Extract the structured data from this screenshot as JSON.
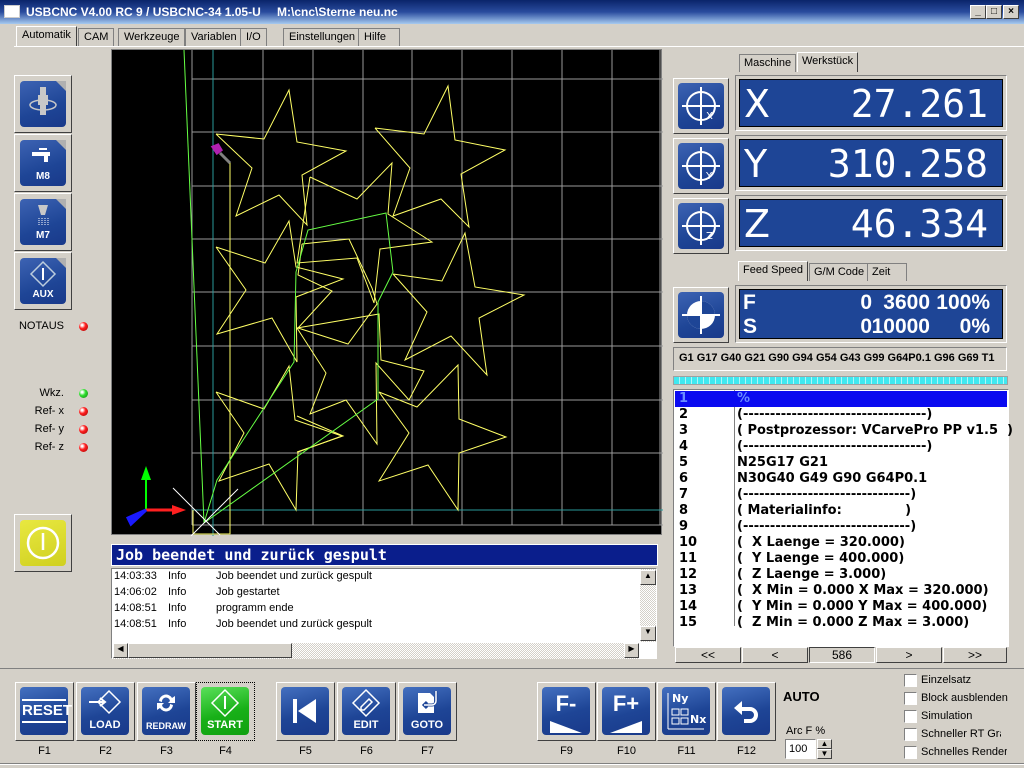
{
  "window": {
    "title": "USBCNC V4.00 RC 9 / USBCNC-34 1.05-U",
    "file": "M:\\cnc\\Sterne neu.nc",
    "minimize": "_",
    "maximize": "□",
    "close": "×"
  },
  "tabs": [
    {
      "label": "Automatik",
      "active": true
    },
    {
      "label": "CAM"
    },
    {
      "label": "Werkzeuge"
    },
    {
      "label": "Variablen"
    },
    {
      "label": "I/O"
    },
    {
      "label": "Einstellungen"
    },
    {
      "label": "Hilfe"
    }
  ],
  "side_buttons": [
    {
      "icon": "spindle-icon",
      "label": ""
    },
    {
      "icon": "flood-coolant-icon",
      "label": "M8"
    },
    {
      "icon": "mist-coolant-icon",
      "label": "M7"
    },
    {
      "icon": "aux-icon",
      "label": "AUX"
    }
  ],
  "status": {
    "notaus": {
      "label": "NOTAUS",
      "color": "red"
    },
    "leds": [
      {
        "label": "Wkz.",
        "color": "green"
      },
      {
        "label": "Ref- x",
        "color": "red"
      },
      {
        "label": "Ref- y",
        "color": "red"
      },
      {
        "label": "Ref- z",
        "color": "red"
      }
    ]
  },
  "dro": {
    "tabs": [
      {
        "label": "Maschine"
      },
      {
        "label": "Werkstück",
        "active": true
      }
    ],
    "axes": [
      {
        "axis": "X",
        "value": "27.261"
      },
      {
        "axis": "Y",
        "value": "310.258"
      },
      {
        "axis": "Z",
        "value": "46.334"
      }
    ]
  },
  "feed": {
    "tabs": [
      {
        "label": "Feed Speed",
        "active": true
      },
      {
        "label": "G/M Code"
      },
      {
        "label": "Zeit"
      }
    ],
    "rows": [
      {
        "label": "F",
        "actual": "0",
        "set": "3600",
        "override": "100%"
      },
      {
        "label": "S",
        "actual": "0",
        "set": "10000",
        "override": "0%"
      }
    ]
  },
  "active_gcodes": "G1 G17 G40 G21 G90 G94 G54 G43 G99 G64P0.1 G96 G69 T1",
  "program": {
    "lines": [
      {
        "n": "1",
        "text": "%"
      },
      {
        "n": "2",
        "text": "(----------------------------------)"
      },
      {
        "n": "3",
        "text": "( Postprozessor: VCarvePro PP v1.5  )"
      },
      {
        "n": "4",
        "text": "(----------------------------------)"
      },
      {
        "n": "5",
        "text": "N25G17 G21"
      },
      {
        "n": "6",
        "text": "N30G40 G49 G90 G64P0.1"
      },
      {
        "n": "7",
        "text": "(-------------------------------)"
      },
      {
        "n": "8",
        "text": "( Materialinfo:              )"
      },
      {
        "n": "9",
        "text": "(-------------------------------)"
      },
      {
        "n": "10",
        "text": "(  X Laenge = 320.000)"
      },
      {
        "n": "11",
        "text": "(  Y Laenge = 400.000)"
      },
      {
        "n": "12",
        "text": "(  Z Laenge = 3.000)"
      },
      {
        "n": "13",
        "text": "(  X Min = 0.000 X Max = 320.000)"
      },
      {
        "n": "14",
        "text": "(  Y Min = 0.000 Y Max = 400.000)"
      },
      {
        "n": "15",
        "text": "(  Z Min = 0.000 Z Max = 3.000)"
      }
    ],
    "selected_line": 1,
    "nav": {
      "first": "<<",
      "prev": "<",
      "line_count": "586",
      "next": ">",
      "last": ">>"
    }
  },
  "message": "Job beendet und zurück gespult",
  "log": [
    {
      "time": "14:03:33",
      "level": "Info",
      "text": "Job beendet und zurück gespult"
    },
    {
      "time": "14:06:02",
      "level": "Info",
      "text": "Job gestartet"
    },
    {
      "time": "14:08:51",
      "level": "Info",
      "text": " programm ende"
    },
    {
      "time": "14:08:51",
      "level": "Info",
      "text": "Job beendet und zurück gespult"
    }
  ],
  "toolbar": {
    "buttons": [
      {
        "label": "RESET",
        "key": "F1"
      },
      {
        "label": "LOAD",
        "key": "F2"
      },
      {
        "label": "REDRAW",
        "key": "F3"
      },
      {
        "label": "START",
        "key": "F4"
      },
      {
        "label": "",
        "key": "F5"
      },
      {
        "label": "EDIT",
        "key": "F6"
      },
      {
        "label": "GOTO",
        "key": "F7"
      },
      {
        "label": "F-",
        "key": "F9"
      },
      {
        "label": "F+",
        "key": "F10"
      },
      {
        "label": "Ny Nx",
        "key": "F11"
      },
      {
        "label": "",
        "key": "F12"
      }
    ],
    "mode": "AUTO",
    "arc_label": "Arc F %",
    "arc_value": "100"
  },
  "options": [
    {
      "label": "Einzelsatz",
      "checked": false
    },
    {
      "label": "Block ausblenden",
      "checked": false
    },
    {
      "label": "Simulation",
      "checked": false
    },
    {
      "label": "Schneller RT Gra",
      "checked": false
    },
    {
      "label": "Schnelles Render",
      "checked": false
    }
  ],
  "colors": {
    "dro_bg": "#1e4596",
    "toolpath": "#ffff66",
    "rapid": "#66ff44",
    "grid": "#a0a0a0",
    "message_bg": "#0a1e8c",
    "start_button": "#18b018"
  }
}
